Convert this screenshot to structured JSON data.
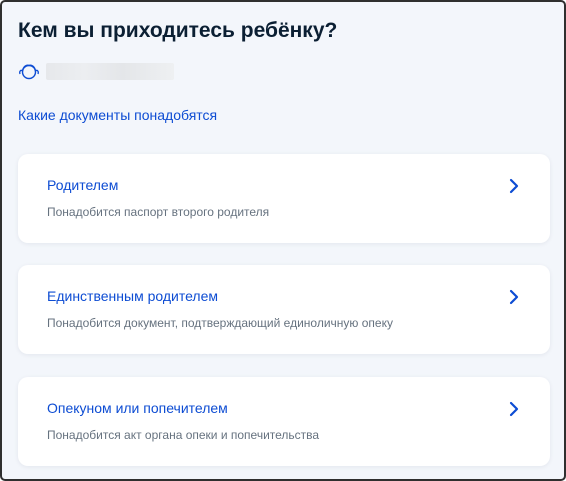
{
  "page": {
    "title": "Кем вы приходитесь ребёнку?"
  },
  "child": {
    "icon": "child-face-icon",
    "name_redacted": true
  },
  "documents_link": {
    "label": "Какие документы понадобятся"
  },
  "options": [
    {
      "title": "Родителем",
      "description": "Понадобится паспорт второго родителя",
      "icon": "chevron-right-icon"
    },
    {
      "title": "Единственным родителем",
      "description": "Понадобится документ, подтверждающий единоличную опеку",
      "icon": "chevron-right-icon"
    },
    {
      "title": "Опекуном или попечителем",
      "description": "Понадобится акт органа опеки и попечительства",
      "icon": "chevron-right-icon"
    }
  ],
  "colors": {
    "accent": "#0d4cd3",
    "title_text": "#0b1f33",
    "secondary_text": "#66727f",
    "background": "#f3f6fb",
    "card_background": "#ffffff"
  }
}
